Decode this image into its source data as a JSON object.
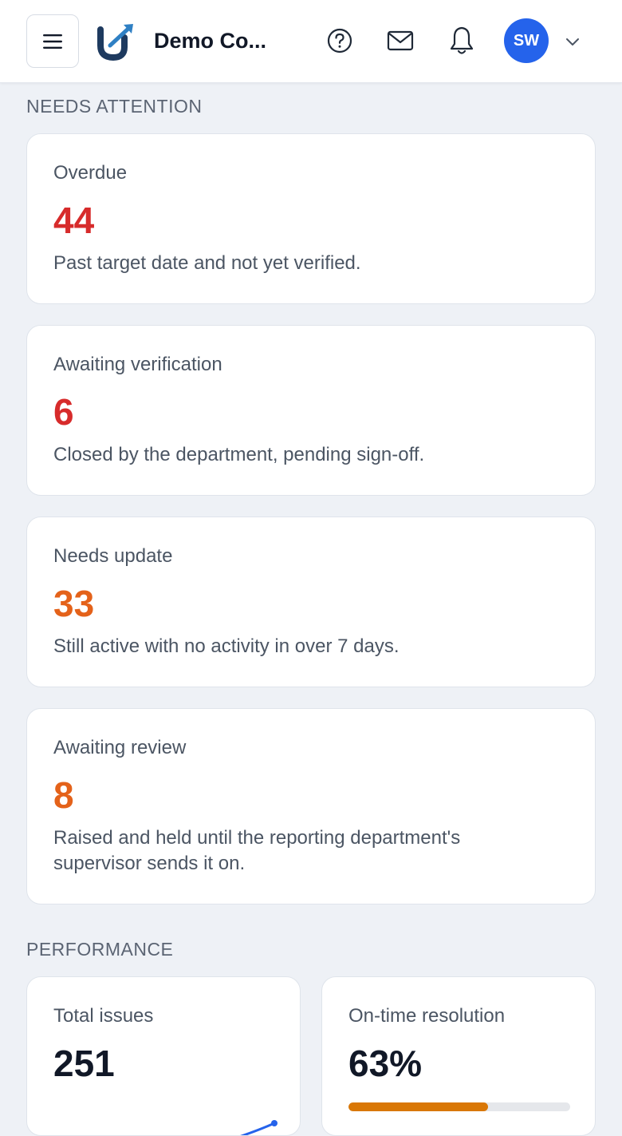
{
  "header": {
    "company_name": "Demo Co...",
    "avatar_initials": "SW",
    "icons": [
      "menu-icon",
      "help-icon",
      "mail-icon",
      "bell-icon",
      "chevron-down-icon"
    ],
    "colors": {
      "avatar": "#2563eb",
      "logo_dark": "#1e3a5f",
      "logo_accent": "#2f80c4"
    }
  },
  "needs_attention": {
    "label": "NEEDS ATTENTION",
    "cards": [
      {
        "title": "Overdue",
        "value": "44",
        "description": "Past target date and not yet verified.",
        "color": "#d72b2b"
      },
      {
        "title": "Awaiting verification",
        "value": "6",
        "description": "Closed by the department, pending sign-off.",
        "color": "#d72b2b"
      },
      {
        "title": "Needs update",
        "value": "33",
        "description": "Still active with no activity in over 7 days.",
        "color": "#e4621a"
      },
      {
        "title": "Awaiting review",
        "value": "8",
        "description": "Raised and held until the reporting department's supervisor sends it on.",
        "color": "#e4621a"
      }
    ]
  },
  "performance": {
    "label": "PERFORMANCE",
    "total_issues": {
      "title": "Total issues",
      "value": "251",
      "sparkline_color": "#2563eb"
    },
    "on_time": {
      "title": "On-time resolution",
      "value": "63%",
      "progress": 0.63,
      "progress_color": "#d97706"
    }
  }
}
